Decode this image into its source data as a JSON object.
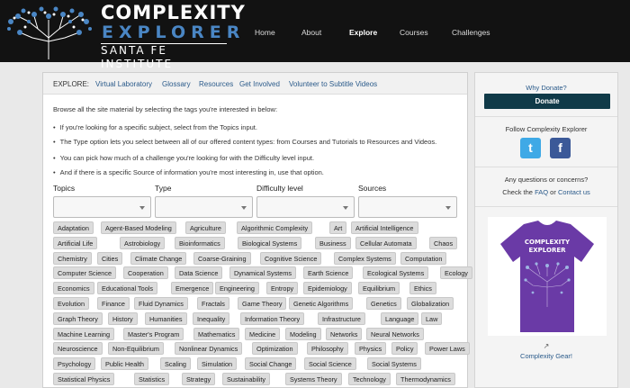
{
  "brand": {
    "line1": "COMPLEXITY",
    "line2": "EXPLORER",
    "line3": "SANTA FE INSTITUTE"
  },
  "nav": [
    "Home",
    "About",
    "Explore",
    "Courses",
    "Challenges"
  ],
  "explore": {
    "label": "EXPLORE:",
    "links": [
      "Virtual Laboratory",
      "Glossary",
      "Resources",
      "Get Involved",
      "Volunteer to Subtitle Videos"
    ]
  },
  "intro": "Browse all the site material by selecting the tags you're interested in below:",
  "bullets": [
    "If you're looking for a specific subject, select from the Topics input.",
    "The Type option lets you select between all of our offered content types: from Courses and Tutorials to Resources and Videos.",
    "You can pick how much of a challenge you're looking for with the Difficulty level input.",
    "And if there is a specific Source of information you're most interesting in, use that option."
  ],
  "filters": [
    "Topics",
    "Type",
    "Difficulty level",
    "Sources"
  ],
  "tags": [
    [
      "Adaptation",
      "Agent-Based Modeling",
      "Agriculture",
      "Algorithmic Complexity",
      "Art",
      "Artificial Intelligence"
    ],
    [
      "Artificial Life",
      "Astrobiology",
      "Bioinformatics",
      "Biological Systems",
      "Business",
      "Cellular Automata",
      "Chaos"
    ],
    [
      "Chemistry",
      "Cities",
      "Climate Change",
      "Coarse-Graining",
      "Cognitive Science",
      "Complex Systems",
      "Computation"
    ],
    [
      "Computer Science",
      "Cooperation",
      "Data Science",
      "Dynamical Systems",
      "Earth Science",
      "Ecological Systems",
      "Ecology"
    ],
    [
      "Economics",
      "Educational Tools",
      "Emergence",
      "Engineering",
      "Entropy",
      "Epidemiology",
      "Equilibrium",
      "Ethics"
    ],
    [
      "Evolution",
      "Finance",
      "Fluid Dynamics",
      "Fractals",
      "Game Theory",
      "Genetic Algorithms",
      "Genetics",
      "Globalization"
    ],
    [
      "Graph Theory",
      "History",
      "Humanities",
      "Inequality",
      "Information Theory",
      "Infrastructure",
      "Language",
      "Law"
    ],
    [
      "Machine Learning",
      "Master's Program",
      "Mathematics",
      "Medicine",
      "Modeling",
      "Networks",
      "Neural Networks"
    ],
    [
      "Neuroscience",
      "Non-Equilibrium",
      "Nonlinear Dynamics",
      "Optimization",
      "Philosophy",
      "Physics",
      "Policy",
      "Power Laws"
    ],
    [
      "Psychology",
      "Public Health",
      "Scaling",
      "Simulation",
      "Social Change",
      "Social Science",
      "Social Systems"
    ],
    [
      "Statistical Physics",
      "Statistics",
      "Strategy",
      "Sustainability",
      "Systems Theory",
      "Technology",
      "Thermodynamics"
    ]
  ],
  "sidebar": {
    "why_donate": "Why Donate?",
    "donate": "Donate",
    "follow": "Follow Complexity Explorer",
    "twitter_icon": "t",
    "facebook_icon": "f",
    "questions": "Any questions or concerns?",
    "check_prefix": "Check the",
    "faq": "FAQ",
    "or": "or",
    "contact": "Contact us",
    "shirt_line1": "COMPLEXITY",
    "shirt_line2": "EXPLORER",
    "gear_link": "Complexity Gear!"
  },
  "colors": {
    "header_bg": "#121212",
    "accent_blue": "#4a86c4",
    "donate_bg": "#103a48",
    "link": "#2a5a8a",
    "shirt": "#6a3aa6"
  }
}
